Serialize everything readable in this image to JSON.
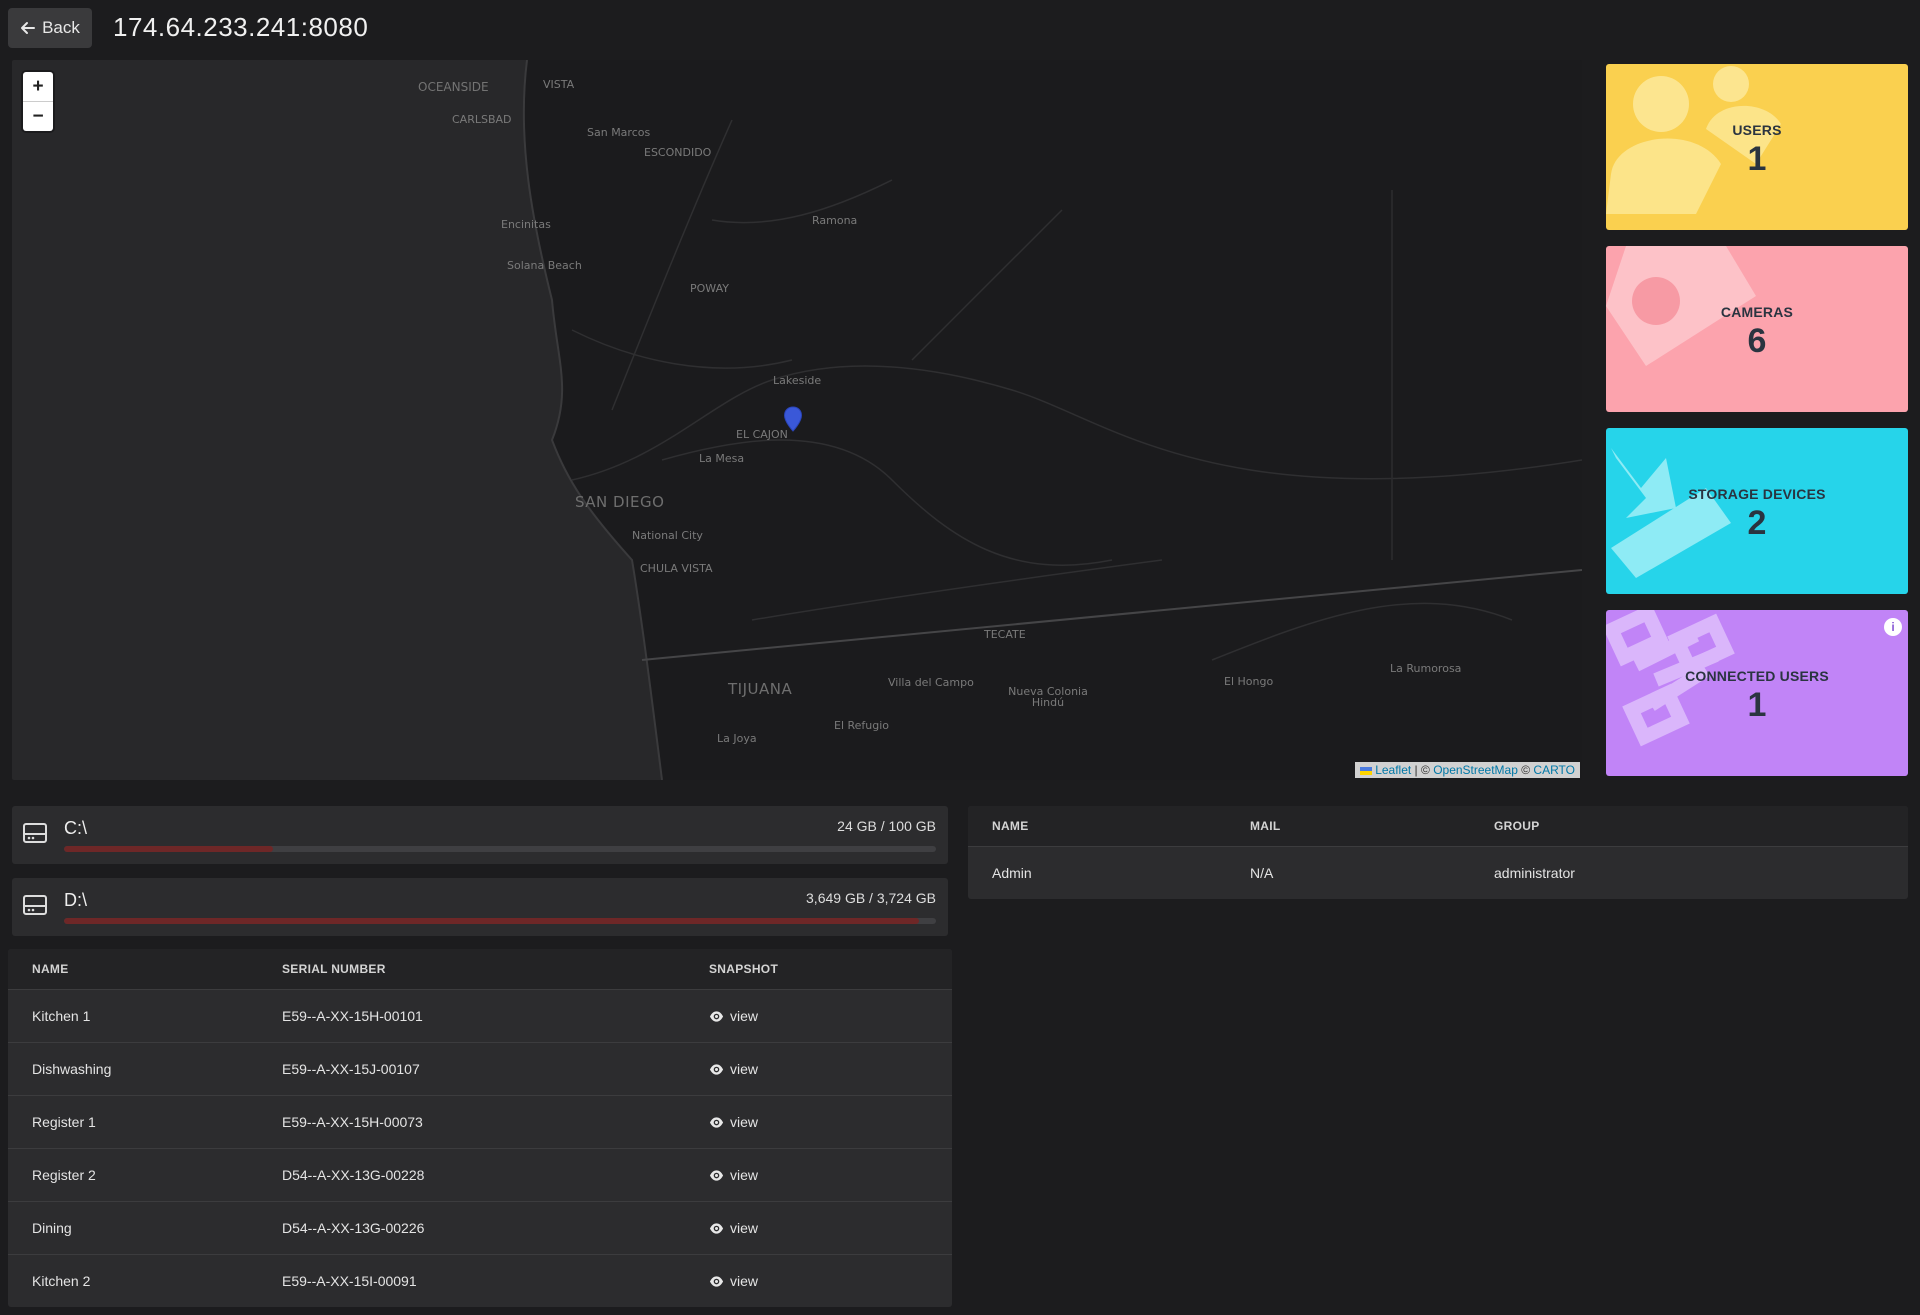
{
  "header": {
    "back_label": "Back",
    "title": "174.64.233.241:8080"
  },
  "map": {
    "zoom_in": "+",
    "zoom_out": "−",
    "labels": {
      "oceanside": "OCEANSIDE",
      "vista": "VISTA",
      "carlsbad": "CARLSBAD",
      "san_marcos": "San Marcos",
      "escondido": "ESCONDIDO",
      "encinitas": "Encinitas",
      "solana_beach": "Solana Beach",
      "ramona": "Ramona",
      "poway": "POWAY",
      "lakeside": "Lakeside",
      "el_cajon": "EL CAJON",
      "la_mesa": "La Mesa",
      "san_diego": "SAN DIEGO",
      "national_city": "National City",
      "chula_vista": "CHULA VISTA",
      "tecate": "TECATE",
      "tijuana": "TIJUANA",
      "villa_del_campo": "Villa del Campo",
      "nueva_colonia": "Nueva Colonia Hindú",
      "el_hongo": "El Hongo",
      "la_rumorosa": "La Rumorosa",
      "el_refugio": "El Refugio",
      "la_joya": "La Joya"
    },
    "attribution": {
      "leaflet": "Leaflet",
      "sep1": " | © ",
      "osm": "OpenStreetMap",
      "sep2": " © ",
      "carto": "CARTO"
    }
  },
  "stats": [
    {
      "label": "USERS",
      "value": "1",
      "color": "#fad04f"
    },
    {
      "label": "CAMERAS",
      "value": "6",
      "color": "#fca3ad"
    },
    {
      "label": "STORAGE DEVICES",
      "value": "2",
      "color": "#26d4ea"
    },
    {
      "label": "CONNECTED USERS",
      "value": "1",
      "color": "#c184f7"
    }
  ],
  "drives": [
    {
      "name": "C:\\",
      "usage": "24 GB / 100 GB",
      "fraction": 0.24
    },
    {
      "name": "D:\\",
      "usage": "3,649 GB / 3,724 GB",
      "fraction": 0.98
    }
  ],
  "cameras_table": {
    "headers": {
      "name": "NAME",
      "serial": "SERIAL NUMBER",
      "snapshot": "SNAPSHOT"
    },
    "view_label": "view",
    "rows": [
      {
        "name": "Kitchen 1",
        "serial": "E59--A-XX-15H-00101"
      },
      {
        "name": "Dishwashing",
        "serial": "E59--A-XX-15J-00107"
      },
      {
        "name": "Register 1",
        "serial": "E59--A-XX-15H-00073"
      },
      {
        "name": "Register 2",
        "serial": "D54--A-XX-13G-00228"
      },
      {
        "name": "Dining",
        "serial": "D54--A-XX-13G-00226"
      },
      {
        "name": "Kitchen 2",
        "serial": "E59--A-XX-15I-00091"
      }
    ]
  },
  "users_table": {
    "headers": {
      "name": "NAME",
      "mail": "MAIL",
      "group": "GROUP"
    },
    "rows": [
      {
        "name": "Admin",
        "mail": "N/A",
        "group": "administrator"
      }
    ]
  },
  "icons": {
    "back": "arrow-left-icon",
    "drive": "hard-drive-icon",
    "view": "eye-icon",
    "info": "info-icon",
    "marker": "map-marker-icon"
  }
}
